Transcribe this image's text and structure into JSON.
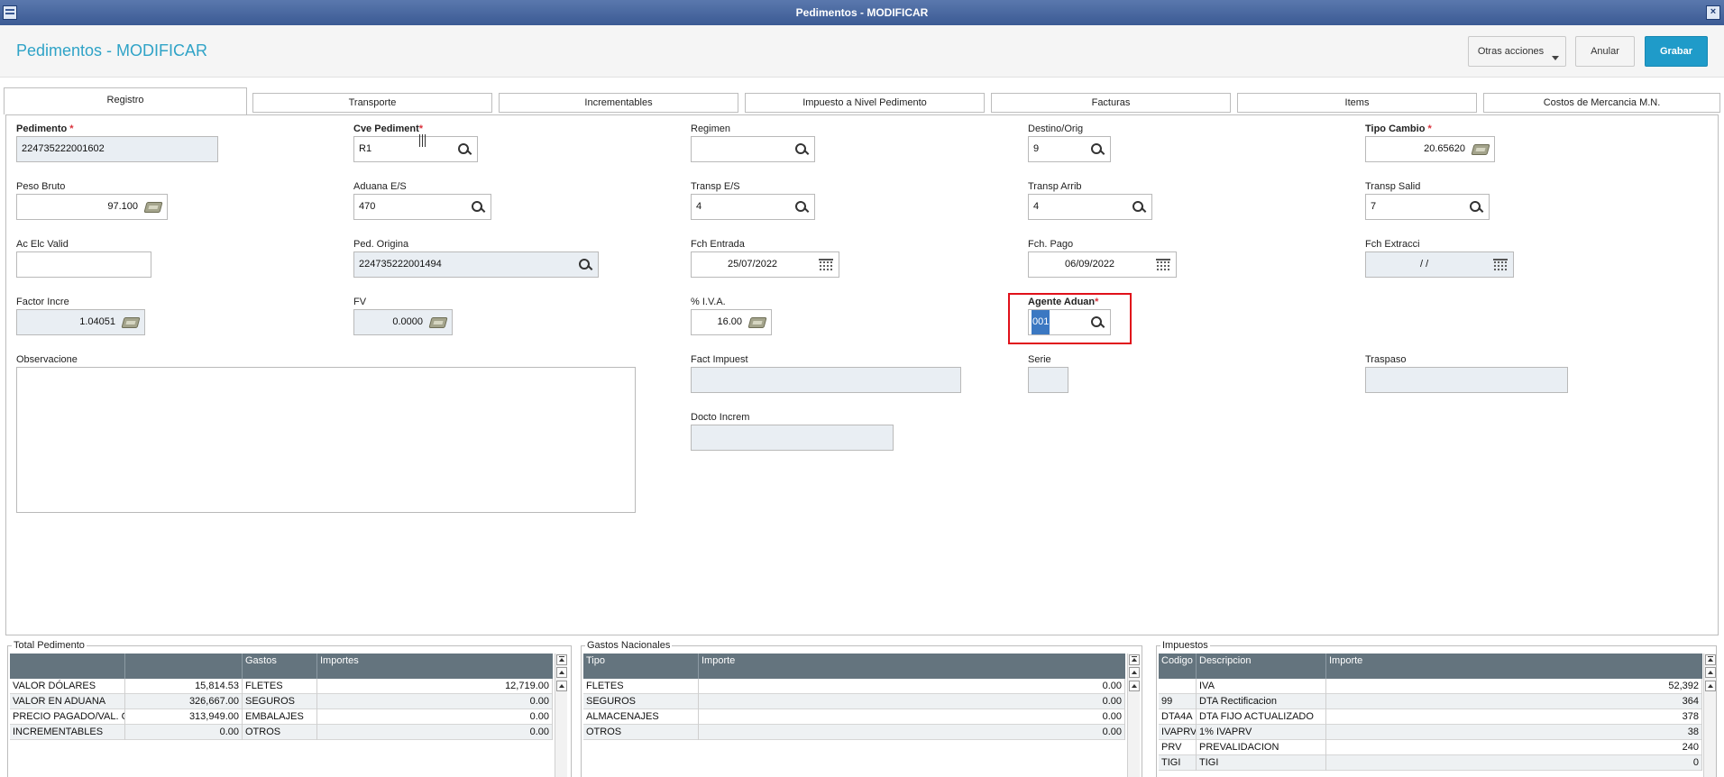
{
  "window": {
    "title": "Pedimentos - MODIFICAR"
  },
  "header": {
    "title": "Pedimentos - MODIFICAR",
    "buttons": {
      "otras": "Otras acciones",
      "anular": "Anular",
      "grabar": "Grabar"
    }
  },
  "tabs": [
    "Registro",
    "Transporte",
    "Incrementables",
    "Impuesto a Nivel Pedimento",
    "Facturas",
    "Items",
    "Costos de Mercancia M.N."
  ],
  "fields": {
    "pedimento": {
      "label": "Pedimento",
      "value": "224735222001602"
    },
    "cve_pediment": {
      "label": "Cve Pediment",
      "value": "R1"
    },
    "regimen": {
      "label": "Regimen",
      "value": ""
    },
    "destino_orig": {
      "label": "Destino/Orig",
      "value": "9"
    },
    "tipo_cambio": {
      "label": "Tipo Cambio",
      "value": "20.65620"
    },
    "peso_bruto": {
      "label": "Peso Bruto",
      "value": "97.100"
    },
    "aduana_es": {
      "label": "Aduana E/S",
      "value": "470"
    },
    "transp_es": {
      "label": "Transp E/S",
      "value": "4"
    },
    "transp_arrib": {
      "label": "Transp Arrib",
      "value": "4"
    },
    "transp_salid": {
      "label": "Transp Salid",
      "value": "7"
    },
    "ac_elc_valid": {
      "label": "Ac Elc Valid",
      "value": ""
    },
    "ped_origina": {
      "label": "Ped. Origina",
      "value": "224735222001494"
    },
    "fch_entrada": {
      "label": "Fch Entrada",
      "value": "25/07/2022"
    },
    "fch_pago": {
      "label": "Fch. Pago",
      "value": "06/09/2022"
    },
    "fch_extracci": {
      "label": "Fch Extracci",
      "value": "/  /"
    },
    "factor_incre": {
      "label": "Factor Incre",
      "value": "1.04051"
    },
    "fv": {
      "label": "FV",
      "value": "0.0000"
    },
    "iva": {
      "label": "% I.V.A.",
      "value": "16.00"
    },
    "agente_aduan": {
      "label": "Agente Aduan",
      "value": "001"
    },
    "observacione": {
      "label": "Observacione",
      "value": ""
    },
    "fact_impuest": {
      "label": "Fact Impuest",
      "value": ""
    },
    "serie": {
      "label": "Serie",
      "value": ""
    },
    "traspaso": {
      "label": "Traspaso",
      "value": ""
    },
    "docto_increm": {
      "label": "Docto Increm",
      "value": ""
    }
  },
  "total_pedimento": {
    "title": "Total Pedimento",
    "headers": [
      "",
      "",
      "Gastos",
      "Importes"
    ],
    "rows": [
      [
        "VALOR DÓLARES",
        "15,814.53",
        "FLETES",
        "12,719.00"
      ],
      [
        "VALOR EN ADUANA",
        "326,667.00",
        "SEGUROS",
        "0.00"
      ],
      [
        "PRECIO PAGADO/VAL. CO",
        "313,949.00",
        "EMBALAJES",
        "0.00"
      ],
      [
        "INCREMENTABLES",
        "0.00",
        "OTROS",
        "0.00"
      ]
    ]
  },
  "gastos_nacionales": {
    "title": "Gastos Nacionales",
    "headers": [
      "Tipo",
      "Importe"
    ],
    "rows": [
      [
        "FLETES",
        "0.00"
      ],
      [
        "SEGUROS",
        "0.00"
      ],
      [
        "ALMACENAJES",
        "0.00"
      ],
      [
        "OTROS",
        "0.00"
      ]
    ]
  },
  "impuestos": {
    "title": "Impuestos",
    "headers": [
      "Codigo",
      "Descripcion",
      "Importe"
    ],
    "rows": [
      [
        "",
        "IVA",
        "52,392"
      ],
      [
        "99",
        "DTA Rectificacion",
        "364"
      ],
      [
        "DTA4A",
        "DTA FIJO ACTUALIZADO",
        "378"
      ],
      [
        "IVAPRV",
        "1% IVAPRV",
        "38"
      ],
      [
        "PRV",
        "PREVALIDACION",
        "240"
      ],
      [
        "TIGI",
        "TIGI",
        "0"
      ]
    ]
  }
}
